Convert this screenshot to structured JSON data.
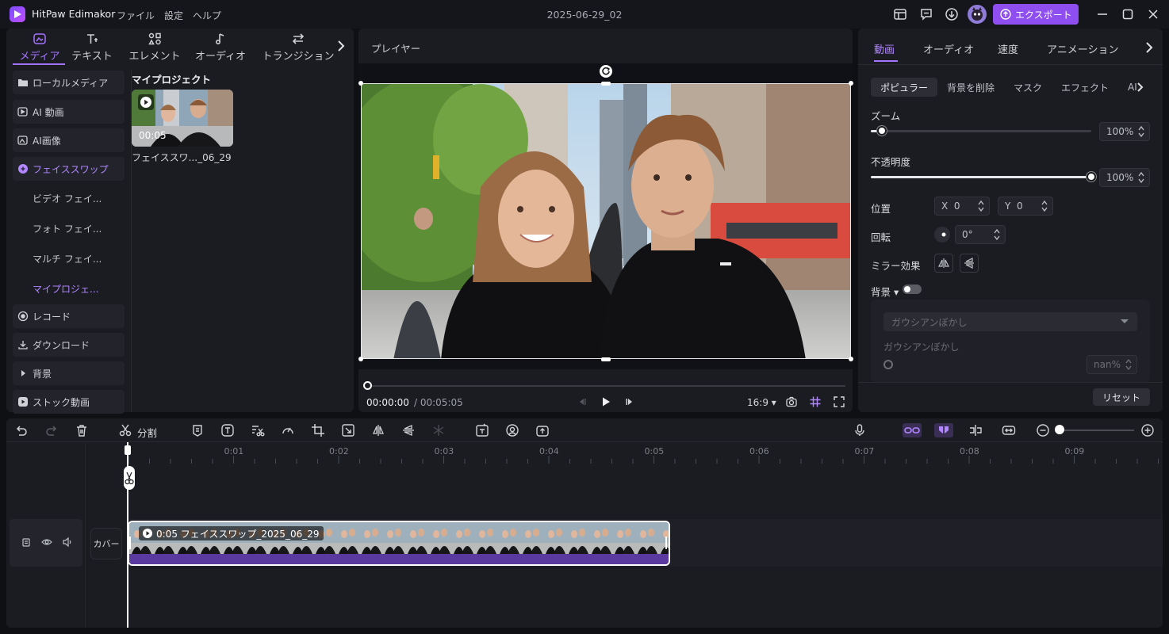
{
  "app": {
    "name": "HitPaw Edimakor",
    "menu": [
      "ファイル",
      "設定",
      "ヘルプ"
    ],
    "document_title": "2025-06-29_02",
    "export_label": "エクスポート",
    "accent": "#8e4ef0"
  },
  "left_panel": {
    "categories": [
      {
        "label": "メディア",
        "icon": "media-icon"
      },
      {
        "label": "テキスト",
        "icon": "text-icon"
      },
      {
        "label": "エレメント",
        "icon": "element-icon"
      },
      {
        "label": "オーディオ",
        "icon": "audio-icon"
      },
      {
        "label": "トランジション",
        "icon": "transition-icon"
      }
    ],
    "sidebar": {
      "local_media": "ローカルメディア",
      "ai_video": "AI 動画",
      "ai_image": "AI画像",
      "face_swap": "フェイススワップ",
      "video_face": "ビデオ フェイ...",
      "photo_face": "フォト フェイ...",
      "multi_face": "マルチ フェイ...",
      "my_projects_sub": "マイプロジェ...",
      "record": "レコード",
      "download": "ダウンロード",
      "background": "背景",
      "stock_video": "ストック動画"
    },
    "project_section_title": "マイプロジェクト",
    "project": {
      "duration": "00:05",
      "name": "フェイススワ..._06_29"
    }
  },
  "player": {
    "title": "プレイヤー",
    "current_time": "00:00:00",
    "total_time": "/ 00:05:05",
    "aspect_ratio": "16:9 ▾",
    "progress": 0
  },
  "right_panel": {
    "tabs": [
      "動画",
      "オーディオ",
      "速度",
      "アニメーション"
    ],
    "sub_tabs": [
      "ポピュラー",
      "背景を削除",
      "マスク",
      "エフェクト",
      "AI"
    ],
    "zoom": {
      "label": "ズーム",
      "value": "100%",
      "fraction": 0.05
    },
    "opacity": {
      "label": "不透明度",
      "value": "100%",
      "fraction": 1.0
    },
    "position": {
      "label": "位置",
      "x_label": "X",
      "x_value": "0",
      "y_label": "Y",
      "y_value": "0"
    },
    "rotation": {
      "label": "回転",
      "value": "0°"
    },
    "mirror": {
      "label": "ミラー効果"
    },
    "background": {
      "label": "背景 ▾",
      "enabled": false
    },
    "blur_select": "ガウシアンぼかし",
    "blur_label": "ガウシアンぼかし",
    "blur_value": "nan%",
    "reset_label": "リセット"
  },
  "timeline": {
    "split_label": "分割",
    "ticks": [
      "0:01",
      "0:02",
      "0:03",
      "0:04",
      "0:05",
      "0:06",
      "0:07",
      "0:08",
      "0:09"
    ],
    "cover_label": "カバー",
    "clip_label": "0:05 フェイススワップ_2025_06_29",
    "zoom_fraction": 0.0
  }
}
